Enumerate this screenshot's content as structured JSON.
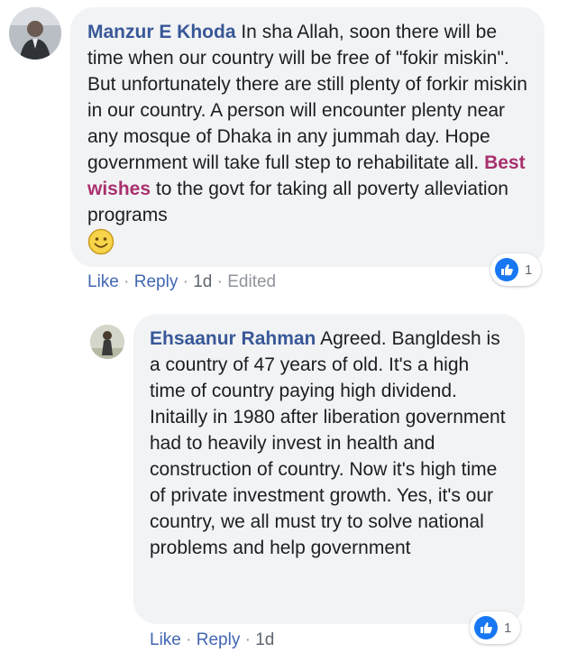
{
  "comments": [
    {
      "author": "Manzur E Khoda",
      "text_before": " In sha Allah, soon there will be time when our country will be free of \"fokir miskin\". But unfortunately there are still plenty of forkir miskin in our country. A person will encounter plenty near any mosque of Dhaka in any jummah day. Hope government will take full step to rehabilitate all. ",
      "highlight": "Best wishes",
      "text_after": " to the govt for taking all poverty alleviation programs",
      "emoji": "slightly-smiling-face",
      "actions": {
        "like": "Like",
        "reply": "Reply",
        "time": "1d",
        "edited": "Edited"
      },
      "reaction_count": "1"
    },
    {
      "author": "Ehsaanur Rahman",
      "text": " Agreed. Bangldesh is a country of 47 years of old. It's a high time of country paying high dividend. Initailly in 1980 after liberation government had to heavily invest in health and construction of country. Now it's high time of private investment growth. Yes, it's our country, we all must try to solve national problems and help government",
      "actions": {
        "like": "Like",
        "reply": "Reply",
        "time": "1d"
      },
      "reaction_count": "1"
    }
  ],
  "separator": " · ",
  "colors": {
    "link": "#4267b2",
    "author": "#385898",
    "highlight": "#a8306e",
    "bubble": "#f2f3f5",
    "like_blue": "#1877f2"
  }
}
